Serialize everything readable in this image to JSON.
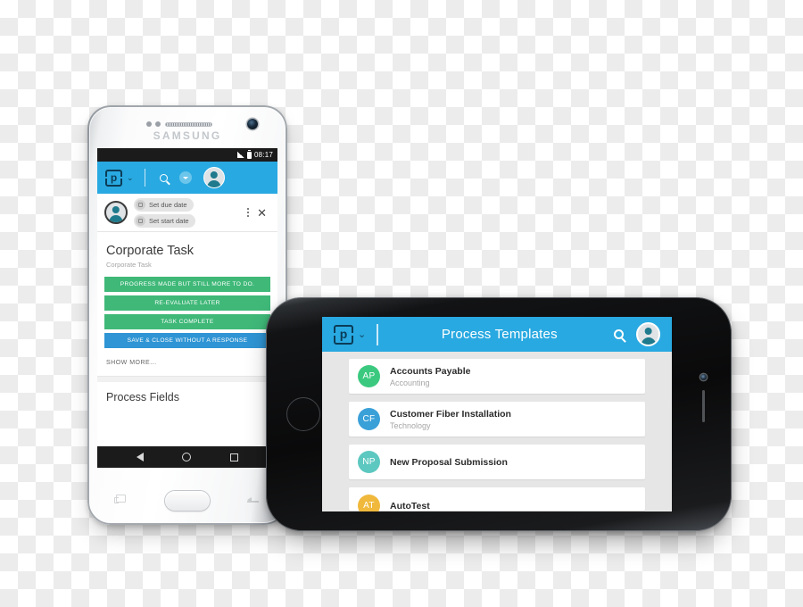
{
  "scene": {
    "description": "Two smartphone mockups showing a process-management mobile app",
    "background": "transparency-checkerboard"
  },
  "colors": {
    "brand_blue": "#29A9E1",
    "action_green": "#3FB878",
    "action_blue": "#2F95D4",
    "avatar_teal": "#1E7A8C",
    "status_bar": "#1B1B1B",
    "list_background": "#E6E6E6"
  },
  "samsung": {
    "device_brand": "SAMSUNG",
    "status_bar": {
      "time": "08:17",
      "signal_icon": "signal-bars-icon",
      "battery_icon": "battery-icon"
    },
    "appbar": {
      "logo_letter": "p",
      "logo_name": "process-logo-icon",
      "chevron": "⌄",
      "search_icon": "search-icon",
      "dropdown_icon": "dropdown-badge-icon",
      "avatar_icon": "user-avatar-icon"
    },
    "subbar": {
      "avatar_icon": "user-avatar-icon",
      "chips": [
        {
          "label": "Set due date",
          "icon": "calendar-icon"
        },
        {
          "label": "Set start date",
          "icon": "calendar-icon"
        }
      ],
      "overflow_icon": "kebab-menu-icon",
      "close_icon": "close-icon",
      "close_glyph": "✕"
    },
    "task": {
      "title": "Corporate Task",
      "subtitle": "Corporate Task"
    },
    "actions": [
      {
        "label": "PROGRESS MADE BUT STILL MORE TO DO.",
        "style": "green"
      },
      {
        "label": "RE-EVALUATE LATER",
        "style": "green"
      },
      {
        "label": "TASK COMPLETE",
        "style": "green"
      },
      {
        "label": "SAVE & CLOSE WITHOUT A RESPONSE",
        "style": "blue"
      }
    ],
    "show_more": "SHOW MORE...",
    "section_heading": "Process Fields",
    "navbar": [
      {
        "name": "back-icon"
      },
      {
        "name": "home-icon"
      },
      {
        "name": "recents-icon"
      }
    ]
  },
  "iphone": {
    "appbar": {
      "logo_letter": "p",
      "logo_name": "process-logo-icon",
      "chevron": "⌄",
      "title": "Process Templates",
      "search_icon": "search-icon",
      "avatar_icon": "user-avatar-icon"
    },
    "templates": [
      {
        "initials": "AP",
        "name": "Accounts Payable",
        "category": "Accounting",
        "color": "#3BC97F"
      },
      {
        "initials": "CF",
        "name": "Customer Fiber Installation",
        "category": "Technology",
        "color": "#3AA0D8"
      },
      {
        "initials": "NP",
        "name": "New Proposal Submission",
        "category": "",
        "color": "#5DC8C0"
      },
      {
        "initials": "AT",
        "name": "AutoTest",
        "category": "",
        "color": "#F0B93C"
      }
    ]
  }
}
